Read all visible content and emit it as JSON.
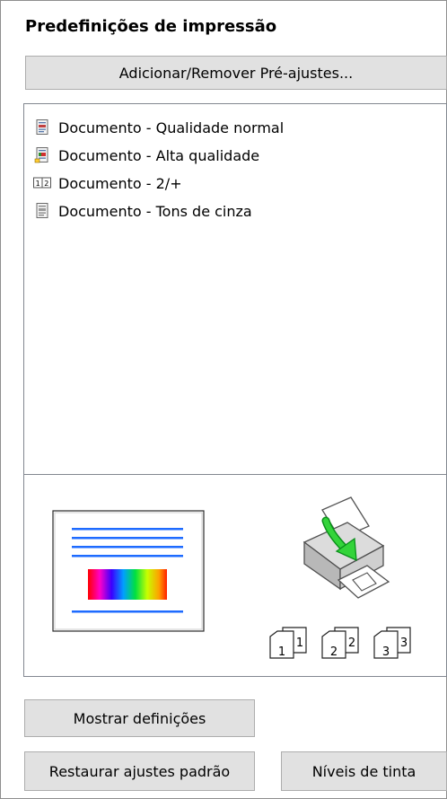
{
  "panel": {
    "title": "Predefinições de impressão",
    "add_remove_label": "Adicionar/Remover Pré-ajustes..."
  },
  "presets": [
    {
      "label": "Documento - Qualidade normal",
      "icon": "document-normal-icon"
    },
    {
      "label": "Documento - Alta qualidade",
      "icon": "document-high-quality-icon"
    },
    {
      "label": "Documento - 2/+",
      "icon": "two-up-icon"
    },
    {
      "label": "Documento - Tons de cinza",
      "icon": "document-grayscale-icon"
    }
  ],
  "preview": {
    "printer_icon": "printer-icon",
    "collate_icons": [
      "1",
      "2",
      "3"
    ]
  },
  "buttons": {
    "show_settings": "Mostrar definições",
    "restore_defaults": "Restaurar ajustes padrão",
    "ink_levels": "Níveis de tinta"
  }
}
